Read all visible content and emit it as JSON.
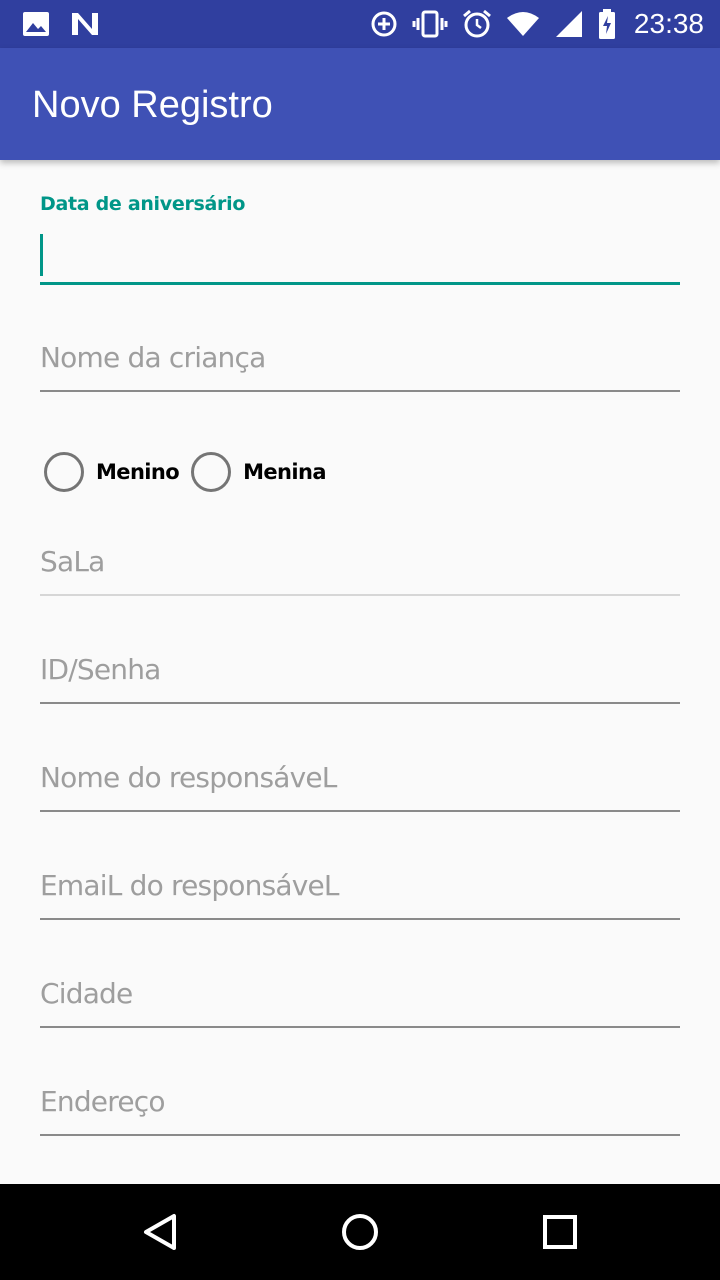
{
  "status_bar": {
    "time": "23:38",
    "left_icons": [
      "image-icon",
      "n-icon"
    ],
    "right_icons": [
      "data-saver-icon",
      "vibrate-icon",
      "alarm-icon",
      "wifi-icon",
      "signal-icon",
      "battery-charging-icon"
    ]
  },
  "app_bar": {
    "title": "Novo Registro"
  },
  "form": {
    "birthday_label": "Data de aniversário",
    "child_name_placeholder": "Nome da criança",
    "gender_options": [
      "Menino",
      "Menina"
    ],
    "room_placeholder": "SaLa",
    "id_placeholder": "ID/Senha",
    "guardian_name_placeholder": "Nome do responsáveL",
    "guardian_email_placeholder": "EmaiL do responsáveL",
    "city_placeholder": "Cidade",
    "address_placeholder": "Endereço"
  },
  "colors": {
    "status_bar": "#303f9f",
    "app_bar": "#3f51b5",
    "accent": "#009688",
    "background": "#fafafa",
    "hint": "#9e9e9e"
  },
  "nav_bar": {
    "icons": [
      "back-icon",
      "home-icon",
      "recents-icon"
    ]
  }
}
